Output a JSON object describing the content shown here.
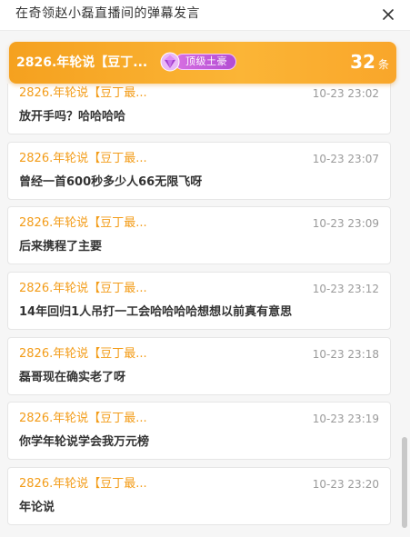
{
  "window": {
    "title": "在奇领赵小磊直播间的弹幕发言",
    "close_icon": "close-icon"
  },
  "header": {
    "user_name": "2826.年轮说【豆丁...",
    "badge_label": "顶级土豪",
    "badge_icon": "purple-gem-icon",
    "count": "32",
    "count_unit": "条",
    "colors": {
      "card_gradient_start": "#f5a11f",
      "card_gradient_end": "#fbb536",
      "badge_purple": "#b24cd3"
    }
  },
  "messages": [
    {
      "name": "2826.年轮说【豆丁最...",
      "time": "10-23 23:02",
      "text": "放开手吗？哈哈哈哈"
    },
    {
      "name": "2826.年轮说【豆丁最...",
      "time": "10-23 23:07",
      "text": "曾经一首600秒多少人66无限飞呀"
    },
    {
      "name": "2826.年轮说【豆丁最...",
      "time": "10-23 23:09",
      "text": "后来携程了主要"
    },
    {
      "name": "2826.年轮说【豆丁最...",
      "time": "10-23 23:12",
      "text": "14年回归1人吊打一工会哈哈哈哈想想以前真有意思"
    },
    {
      "name": "2826.年轮说【豆丁最...",
      "time": "10-23 23:18",
      "text": "磊哥现在确实老了呀"
    },
    {
      "name": "2826.年轮说【豆丁最...",
      "time": "10-23 23:19",
      "text": "你学年轮说学会我万元榜"
    },
    {
      "name": "2826.年轮说【豆丁最...",
      "time": "10-23 23:20",
      "text": "年论说"
    }
  ],
  "colors": {
    "name_orange": "#f39c18",
    "time_gray": "#9a9a9a",
    "text_dark": "#333333",
    "background": "#f6f6f6"
  }
}
